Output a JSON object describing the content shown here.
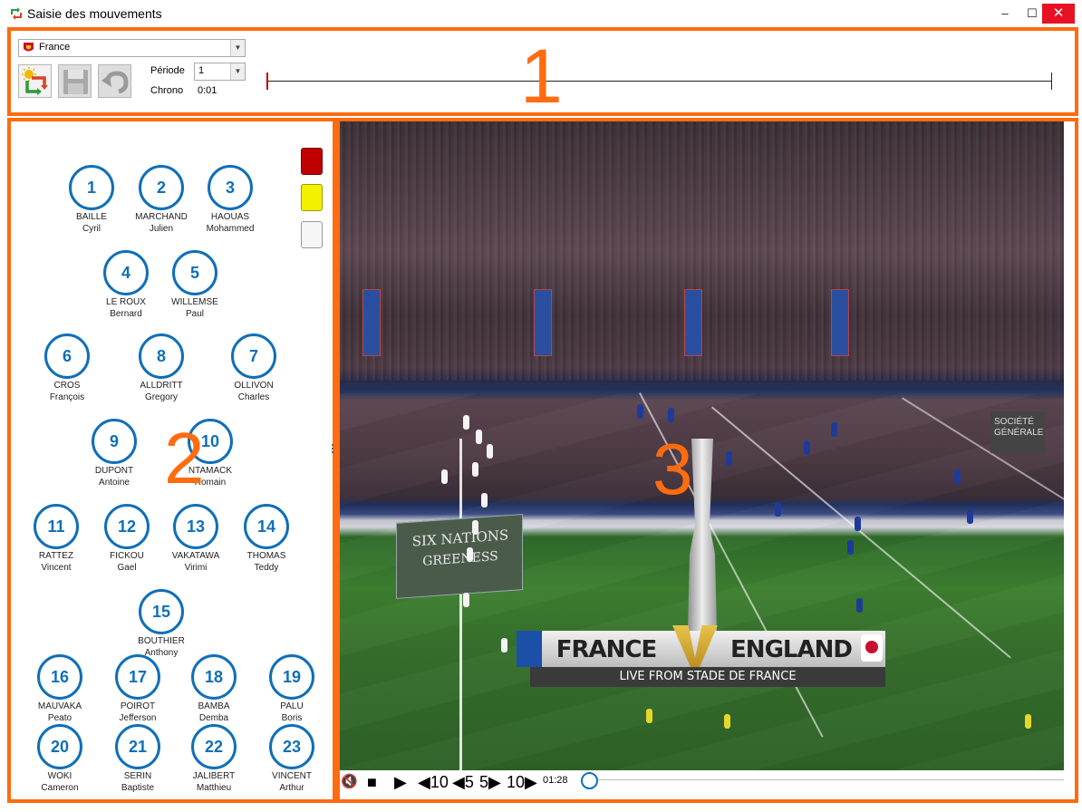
{
  "window": {
    "title": "Saisie des mouvements",
    "minimize": "–",
    "maximize": "☐",
    "close": "✕"
  },
  "regions": {
    "r1": "1",
    "r2": "2",
    "r3": "3",
    "color": "#ff6b0f"
  },
  "toolbar": {
    "team": "France",
    "periode_label": "Période",
    "periode_value": "1",
    "chrono_label": "Chrono",
    "chrono_value": "0:01",
    "new_icon": "new-movement-icon",
    "save_icon": "save-icon",
    "undo_icon": "undo-icon"
  },
  "cards": [
    {
      "name": "red-card",
      "color": "#c00000"
    },
    {
      "name": "yellow-card",
      "color": "#f2f200"
    },
    {
      "name": "white-card",
      "color": "#f6f6f6"
    }
  ],
  "players": [
    {
      "number": "1",
      "last": "BAILLE",
      "first": "Cyril"
    },
    {
      "number": "2",
      "last": "MARCHAND",
      "first": "Julien"
    },
    {
      "number": "3",
      "last": "HAOUAS",
      "first": "Mohammed"
    },
    {
      "number": "4",
      "last": "LE ROUX",
      "first": "Bernard"
    },
    {
      "number": "5",
      "last": "WILLEMSE",
      "first": "Paul"
    },
    {
      "number": "6",
      "last": "CROS",
      "first": "François"
    },
    {
      "number": "8",
      "last": "ALLDRITT",
      "first": "Gregory"
    },
    {
      "number": "7",
      "last": "OLLIVON",
      "first": "Charles"
    },
    {
      "number": "9",
      "last": "DUPONT",
      "first": "Antoine"
    },
    {
      "number": "10",
      "last": "NTAMACK",
      "first": "Romain"
    },
    {
      "number": "11",
      "last": "RATTEZ",
      "first": "Vincent"
    },
    {
      "number": "12",
      "last": "FICKOU",
      "first": "Gael"
    },
    {
      "number": "13",
      "last": "VAKATAWA",
      "first": "Virimi"
    },
    {
      "number": "14",
      "last": "THOMAS",
      "first": "Teddy"
    },
    {
      "number": "15",
      "last": "BOUTHIER",
      "first": "Anthony"
    },
    {
      "number": "16",
      "last": "MAUVAKA",
      "first": "Peato"
    },
    {
      "number": "17",
      "last": "POIROT",
      "first": "Jefferson"
    },
    {
      "number": "18",
      "last": "BAMBA",
      "first": "Demba"
    },
    {
      "number": "19",
      "last": "PALU",
      "first": "Boris"
    },
    {
      "number": "20",
      "last": "WOKI",
      "first": "Cameron"
    },
    {
      "number": "21",
      "last": "SERIN",
      "first": "Baptiste"
    },
    {
      "number": "22",
      "last": "JALIBERT",
      "first": "Matthieu"
    },
    {
      "number": "23",
      "last": "VINCENT",
      "first": "Arthur"
    }
  ],
  "video": {
    "score_team_a": "FRANCE",
    "score_team_b": "ENGLAND",
    "score_subtitle": "LIVE FROM STADE DE FRANCE",
    "board_line1": "SIX NATIONS",
    "board_line2": "GREENESS",
    "sponsor": "SOCIÉTÉ GÉNÉRALE"
  },
  "player_controls": {
    "mute": "🔇",
    "stop": "■",
    "play": "▶",
    "back10": "◀10",
    "back5": "◀5",
    "fwd5": "5▶",
    "fwd10": "10▶",
    "time": "01:28",
    "progress": 0
  }
}
